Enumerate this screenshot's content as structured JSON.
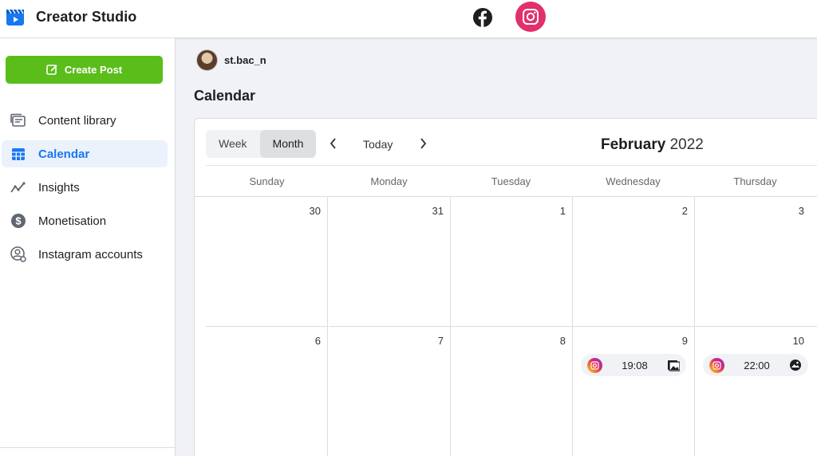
{
  "app": {
    "title": "Creator Studio"
  },
  "platforms": [
    "facebook-icon",
    "instagram-icon"
  ],
  "sidebar": {
    "create_label": "Create Post",
    "items": [
      {
        "label": "Content library",
        "icon": "content-library-icon"
      },
      {
        "label": "Calendar",
        "icon": "calendar-icon",
        "active": true
      },
      {
        "label": "Insights",
        "icon": "insights-icon"
      },
      {
        "label": "Monetisation",
        "icon": "monetisation-icon"
      },
      {
        "label": "Instagram accounts",
        "icon": "instagram-accounts-icon"
      }
    ]
  },
  "account": {
    "name": "st.bac_n"
  },
  "page": {
    "title": "Calendar"
  },
  "calendar": {
    "view_week": "Week",
    "view_month": "Month",
    "today_label": "Today",
    "month": "February",
    "year": "2022",
    "weekdays": [
      "Sunday",
      "Monday",
      "Tuesday",
      "Wednesday",
      "Thursday"
    ],
    "week1": [
      "30",
      "31",
      "1",
      "2",
      "3"
    ],
    "week2": [
      "6",
      "7",
      "8",
      "9",
      "10"
    ],
    "events": [
      {
        "day": "9",
        "time": "19:08",
        "type": "image-post-icon"
      },
      {
        "day": "10",
        "time": "22:00",
        "type": "photo-post-icon"
      }
    ]
  },
  "colors": {
    "accent": "#1877f2",
    "create": "#5bbd1a",
    "instagram": "#e1306c"
  }
}
